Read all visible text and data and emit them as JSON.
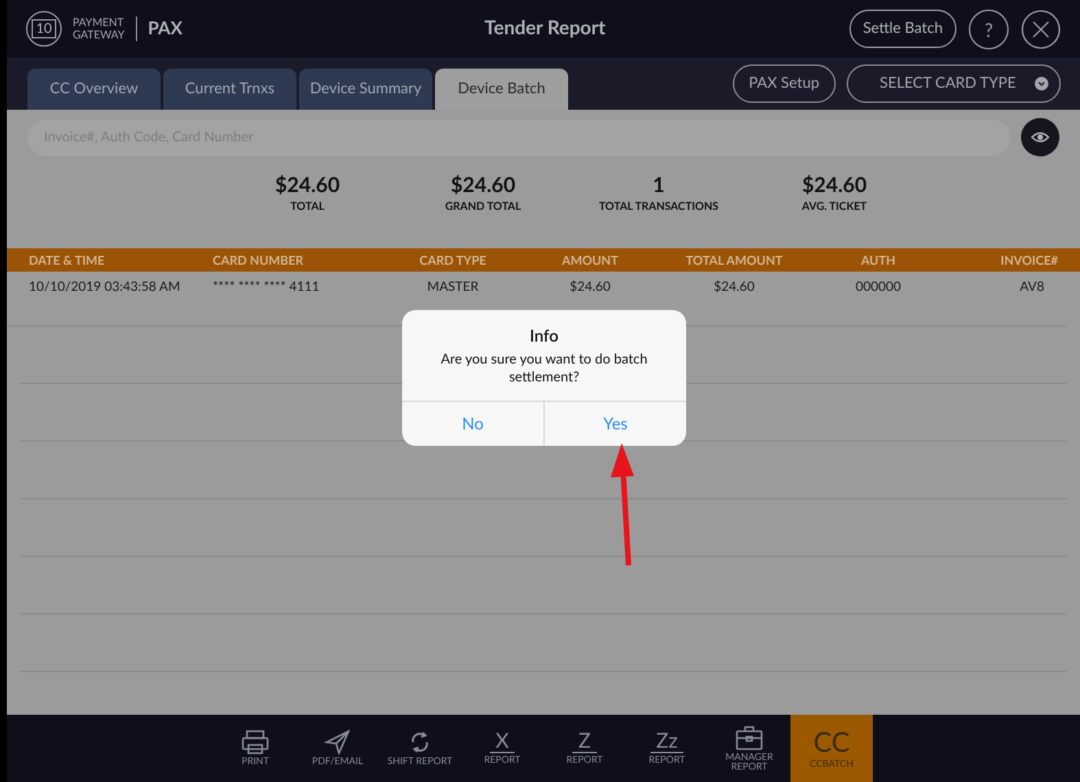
{
  "header": {
    "logo_badge": "10",
    "logo_line1": "PAYMENT",
    "logo_line2": "GATEWAY",
    "brand": "PAX",
    "title": "Tender Report",
    "settle_button": "Settle Batch",
    "help_button": "?"
  },
  "tabs": [
    {
      "label": "CC Overview",
      "selected": false
    },
    {
      "label": "Current Trnxs",
      "selected": false
    },
    {
      "label": "Device Summary",
      "selected": false
    },
    {
      "label": "Device Batch",
      "selected": true
    }
  ],
  "pax_setup_button": "PAX Setup",
  "card_type_select": "SELECT CARD TYPE",
  "search": {
    "placeholder": "Invoice#, Auth Code, Card Number"
  },
  "summary": [
    {
      "value": "$24.60",
      "label": "TOTAL"
    },
    {
      "value": "$24.60",
      "label": "GRAND TOTAL"
    },
    {
      "value": "1",
      "label": "TOTAL TRANSACTIONS"
    },
    {
      "value": "$24.60",
      "label": "AVG. TICKET"
    }
  ],
  "table": {
    "columns": [
      "DATE & TIME",
      "CARD NUMBER",
      "CARD TYPE",
      "AMOUNT",
      "TOTAL AMOUNT",
      "AUTH",
      "INVOICE#"
    ],
    "rows": [
      [
        "10/10/2019 03:43:58 AM",
        "**** **** **** 4111",
        "MASTER",
        "$24.60",
        "$24.60",
        "000000",
        "AV8"
      ]
    ]
  },
  "dialog": {
    "title": "Info",
    "message": "Are you sure you want to do batch settlement?",
    "buttons": [
      "No",
      "Yes"
    ]
  },
  "toolbar": [
    {
      "kind": "print",
      "label": "PRINT",
      "selected": false
    },
    {
      "kind": "send",
      "label": "PDF/EMAIL",
      "selected": false
    },
    {
      "kind": "shift",
      "label": "SHIFT REPORT",
      "selected": false
    },
    {
      "kind": "glyph",
      "glyph": "X",
      "label": "REPORT",
      "selected": false
    },
    {
      "kind": "glyph",
      "glyph": "Z",
      "label": "REPORT",
      "selected": false
    },
    {
      "kind": "glyph",
      "glyph": "Zz",
      "label": "REPORT",
      "selected": false
    },
    {
      "kind": "briefcase",
      "label": "MANAGER REPORT",
      "selected": false
    },
    {
      "kind": "glyph",
      "glyph": "CC",
      "label": "CCBATCH",
      "selected": true
    }
  ]
}
